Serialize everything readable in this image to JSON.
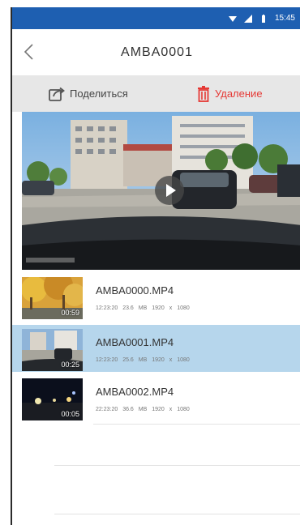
{
  "status_bar": {
    "time": "15:45",
    "background": "#1e5fb1"
  },
  "navbar": {
    "title": "AMBA0001",
    "back_icon": "chevron-left-icon"
  },
  "actions": {
    "share": {
      "label": "Поделиться",
      "icon": "share-icon"
    },
    "delete": {
      "label": "Удаление",
      "icon": "trash-icon",
      "color": "#e53935"
    }
  },
  "preview": {
    "play_icon": "play-icon"
  },
  "files": [
    {
      "name": "AMBA0000.MP4",
      "time": "12:23:20",
      "size": "23.6 MB",
      "resolution": "1920 x 1080",
      "duration": "00:59",
      "selected": false
    },
    {
      "name": "AMBA0001.MP4",
      "time": "12:23:20",
      "size": "25.6 MB",
      "resolution": "1920 x 1080",
      "duration": "00:25",
      "selected": true
    },
    {
      "name": "AMBA0002.MP4",
      "time": "22:23:20",
      "size": "36.6 MB",
      "resolution": "1920 x 1080",
      "duration": "00:05",
      "selected": false
    }
  ],
  "colors": {
    "accent": "#1e5fb1",
    "selected_row": "#b6d6ec",
    "action_bar": "#e7e7e7"
  }
}
